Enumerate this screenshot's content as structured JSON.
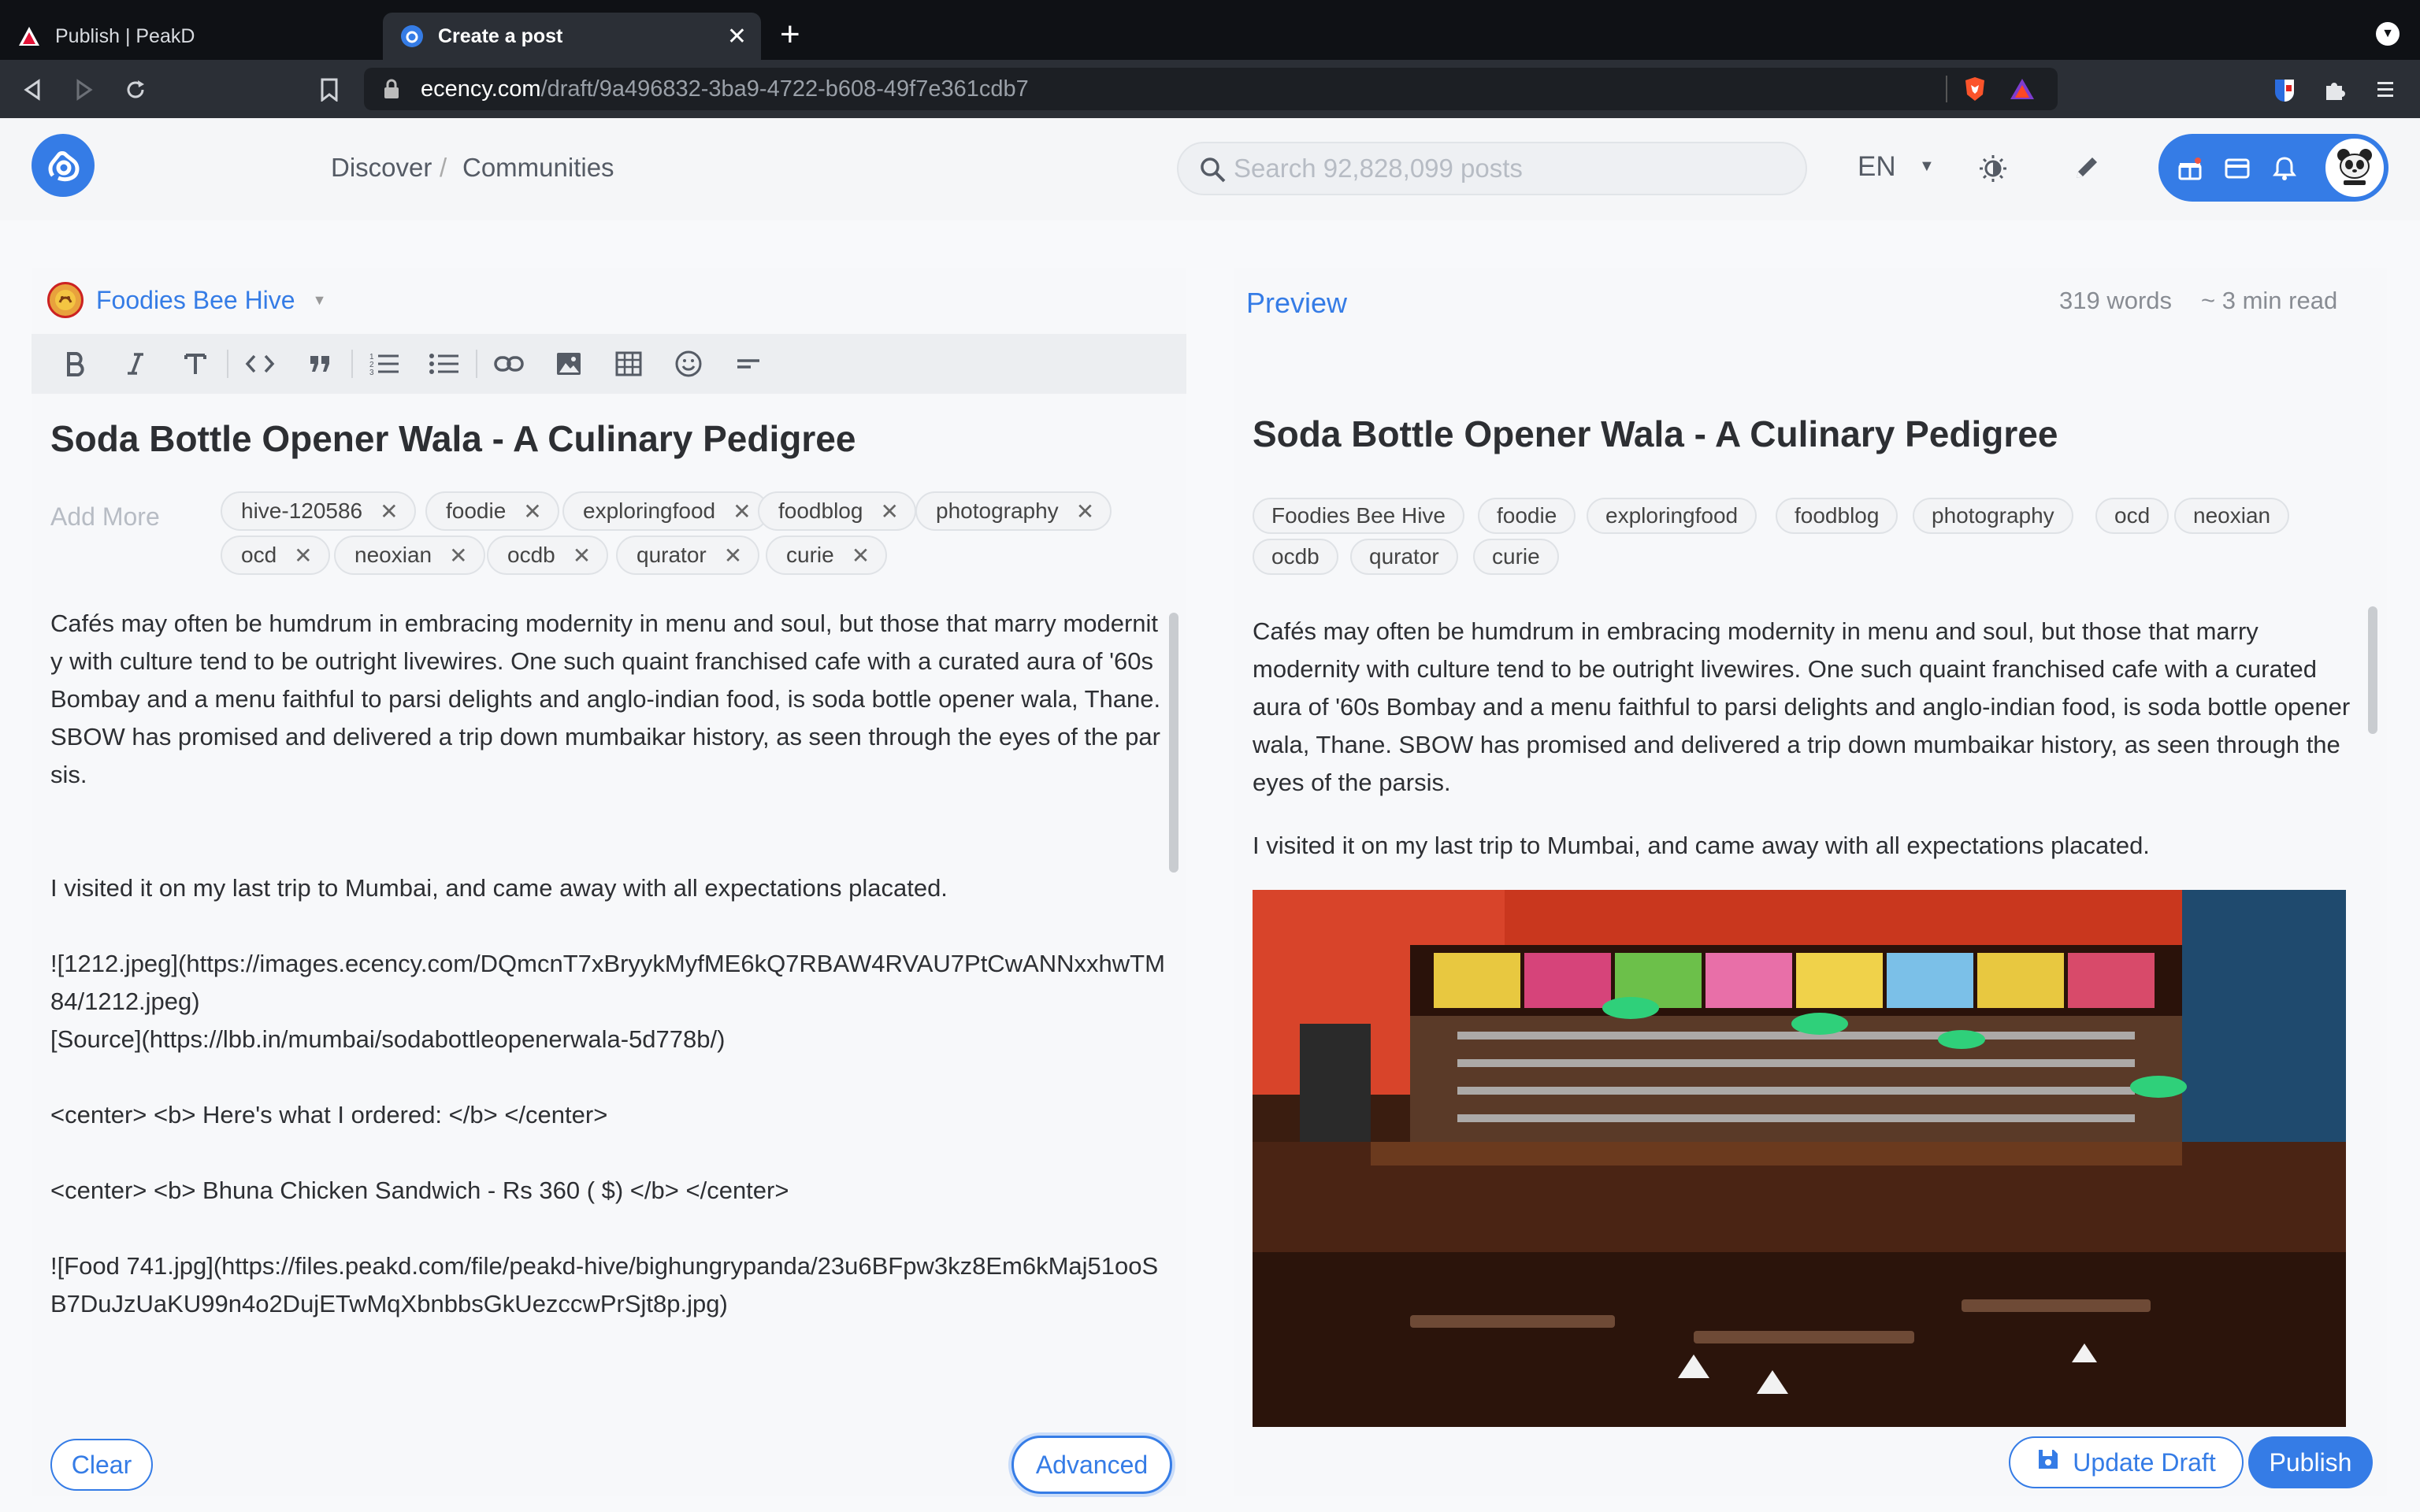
{
  "browser": {
    "tabs": [
      {
        "title": "Publish | PeakD"
      },
      {
        "title": "Create a post"
      }
    ],
    "url_host": "ecency.com",
    "url_path": "/draft/9a496832-3ba9-4722-b608-49f7e361cdb7"
  },
  "header": {
    "nav_discover": "Discover",
    "nav_separator": "/",
    "nav_communities": "Communities",
    "search_placeholder": "Search 92,828,099 posts",
    "language": "EN"
  },
  "editor": {
    "community": "Foodies Bee Hive",
    "title": "Soda Bottle Opener Wala - A Culinary Pedigree",
    "tags_placeholder": "Add More",
    "tags": [
      "hive-120586",
      "foodie",
      "exploringfood",
      "foodblog",
      "photography",
      "ocd",
      "neoxian",
      "ocdb",
      "qurator",
      "curie"
    ],
    "body_lines": [
      "Cafés may often be humdrum in embracing modernity in menu and soul, but those that marry modernity with culture tend to be outright livewires. One such quaint franchised cafe with a curated aura of '60s Bombay and a menu faithful to parsi delights and anglo-indian food, is soda bottle opener wala, Thane. SBOW has promised and delivered a trip down mumbaikar history, as seen through the eyes of the parsis.",
      "",
      "",
      "I visited it on my last trip to Mumbai, and came away with all expectations placated.",
      "",
      "![1212.jpeg](https://images.ecency.com/DQmcnT7xBryykMyfME6kQ7RBAW4RVAU7PtCwANNxxhwTM84/1212.jpeg)",
      "[Source](https://lbb.in/mumbai/sodabottleopenerwala-5d778b/)",
      "",
      "<center> <b> Here's what I ordered: </b> </center>",
      "",
      "<center> <b> Bhuna Chicken Sandwich - Rs 360 ( $) </b> </center>",
      "",
      "![Food 741.jpg](https://files.peakd.com/file/peakd-hive/bighungrypanda/23u6BFpw3kz8Em6kMaj51ooSB7DuJzUaKU99n4o2DujETwMqXbnbbsGkUezccwPrSjt8p.jpg)"
    ],
    "clear_label": "Clear",
    "advanced_label": "Advanced"
  },
  "preview": {
    "label": "Preview",
    "word_count": "319 words",
    "read_time": "~ 3 min read",
    "title": "Soda Bottle Opener Wala - A Culinary Pedigree",
    "tags": [
      "Foodies Bee Hive",
      "foodie",
      "exploringfood",
      "foodblog",
      "photography",
      "ocd",
      "neoxian",
      "ocdb",
      "qurator",
      "curie"
    ],
    "paragraph1": "Cafés may often be humdrum in embracing modernity in menu and soul, but those that marry modernity with culture tend to be outright livewires. One such quaint franchised cafe with a curated aura of '60s Bombay and a menu faithful to parsi delights and anglo-indian food, is soda bottle opener wala, Thane. SBOW has promised and delivered a trip down mumbaikar history, as seen through the eyes of the parsis.",
    "paragraph2": "I visited it on my last trip to Mumbai, and came away with all expectations placated.",
    "update_draft_label": "Update Draft",
    "publish_label": "Publish"
  },
  "colors": {
    "accent": "#357ce6",
    "browser_bg": "#0f1115"
  },
  "icons": [
    "search-icon",
    "theme-toggle-icon",
    "pencil-icon",
    "gift-icon",
    "wallet-icon",
    "bell-icon"
  ]
}
